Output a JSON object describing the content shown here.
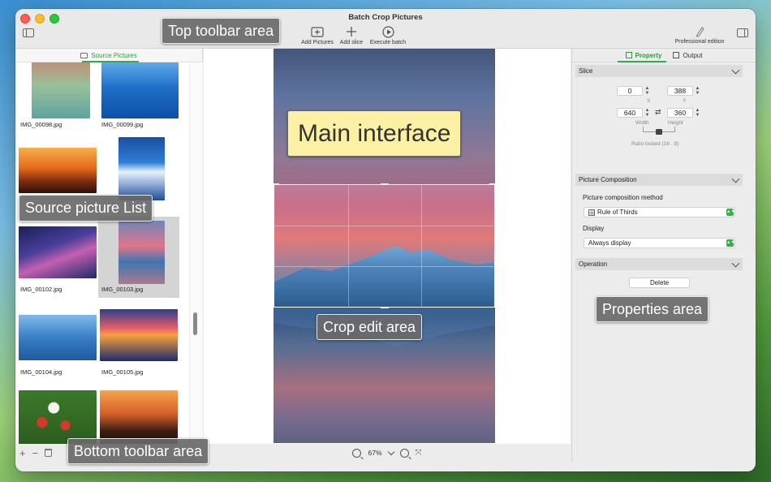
{
  "window": {
    "title": "Batch Crop Pictures"
  },
  "toolbar": {
    "add_pictures": "Add Pictures",
    "add_slice": "Add slice",
    "execute_batch": "Execute batch",
    "professional": "Professional edition"
  },
  "source_panel": {
    "tab_label": "Source Pictures",
    "items": [
      {
        "name": "IMG_00098.jpg"
      },
      {
        "name": "IMG_00099.jpg"
      },
      {
        "name": ""
      },
      {
        "name": ""
      },
      {
        "name": "IMG_00102.jpg"
      },
      {
        "name": "IMG_00103.jpg"
      },
      {
        "name": "IMG_00104.jpg"
      },
      {
        "name": "IMG_00105.jpg"
      },
      {
        "name": ""
      },
      {
        "name": ""
      }
    ],
    "selected_index": 5
  },
  "zoom": {
    "value": "67%"
  },
  "inspector": {
    "tab_property": "Property",
    "tab_output": "Output",
    "slice": {
      "header": "Slice",
      "x": "0",
      "y": "388",
      "width": "640",
      "height": "360",
      "x_label": "X",
      "y_label": "Y",
      "width_label": "Width",
      "height_label": "Height",
      "ratio_text": "Ratio locked (16 : 9)"
    },
    "composition": {
      "header": "Picture Composition",
      "method_label": "Picture composition method",
      "method_value": "Rule of Thirds",
      "display_label": "Display",
      "display_value": "Always display"
    },
    "operation": {
      "header": "Operation",
      "delete_label": "Delete"
    }
  },
  "callouts": {
    "top_toolbar": "Top toolbar area",
    "main_interface": "Main interface",
    "source_list": "Source picture List",
    "crop_edit": "Crop edit area",
    "properties": "Properties area",
    "bottom_toolbar": "Bottom toolbar area"
  },
  "colors": {
    "accent": "#34a853",
    "callout_bg": "#6b6b6b",
    "main_callout_bg": "#fbf0a3"
  }
}
